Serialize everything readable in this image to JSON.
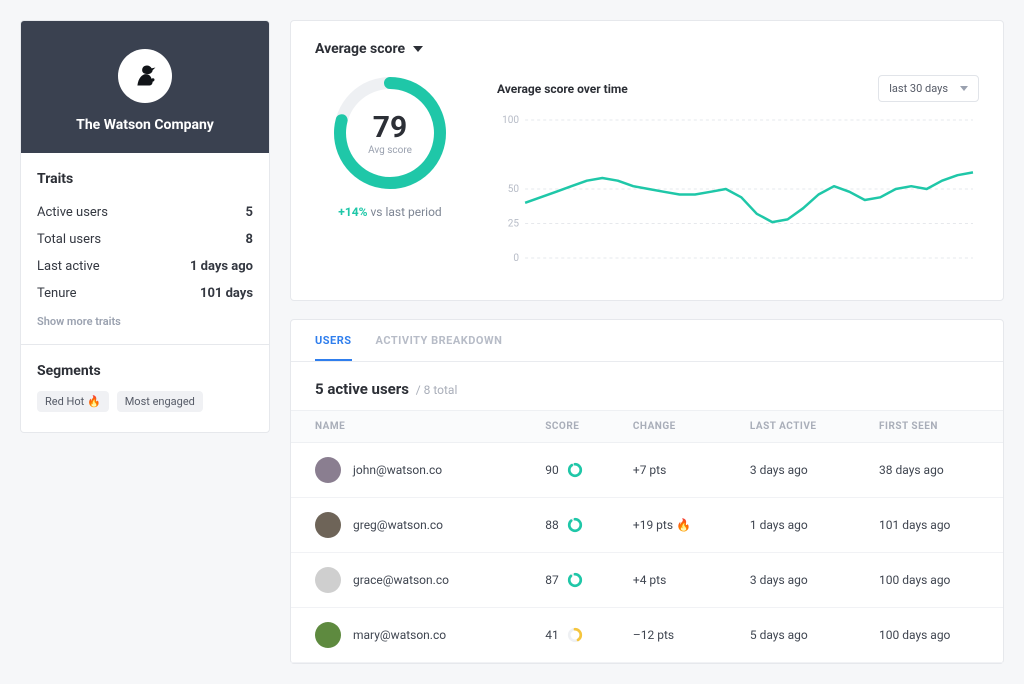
{
  "company": {
    "name": "The Watson Company"
  },
  "traits": {
    "title": "Traits",
    "rows": [
      {
        "label": "Active users",
        "value": "5"
      },
      {
        "label": "Total users",
        "value": "8"
      },
      {
        "label": "Last active",
        "value": "1 days ago"
      },
      {
        "label": "Tenure",
        "value": "101 days"
      }
    ],
    "show_more": "Show more traits"
  },
  "segments": {
    "title": "Segments",
    "tags": [
      "Red Hot 🔥",
      "Most engaged"
    ]
  },
  "score": {
    "header": "Average score",
    "value": "79",
    "value_label": "Avg score",
    "delta_pct": "+14%",
    "delta_suffix": "vs last period"
  },
  "chart_data": {
    "type": "line",
    "title": "Average score over time",
    "range_selected": "last 30 days",
    "ylim": [
      0,
      100
    ],
    "yticks": [
      0,
      25,
      50,
      100
    ],
    "x": [
      0,
      1,
      2,
      3,
      4,
      5,
      6,
      7,
      8,
      9,
      10,
      11,
      12,
      13,
      14,
      15,
      16,
      17,
      18,
      19,
      20,
      21,
      22,
      23,
      24,
      25,
      26,
      27,
      28,
      29
    ],
    "values": [
      40,
      44,
      48,
      52,
      56,
      58,
      56,
      52,
      50,
      48,
      46,
      46,
      48,
      50,
      44,
      32,
      26,
      28,
      36,
      46,
      52,
      48,
      42,
      44,
      50,
      52,
      50,
      56,
      60,
      62
    ]
  },
  "users_panel": {
    "tab_users": "USERS",
    "tab_activity": "ACTIVITY BREAKDOWN",
    "lead": "5 active users",
    "sub": "/ 8 total",
    "columns": {
      "name": "NAME",
      "score": "SCORE",
      "change": "CHANGE",
      "last_active": "LAST ACTIVE",
      "first_seen": "FIRST SEEN"
    },
    "rows": [
      {
        "email": "john@watson.co",
        "score": "90",
        "ring": "#1fc7a8",
        "ring_pct": 90,
        "change": "+7 pts",
        "last_active": "3 days ago",
        "first_seen": "38 days ago",
        "avatar": "#8a7e90"
      },
      {
        "email": "greg@watson.co",
        "score": "88",
        "ring": "#1fc7a8",
        "ring_pct": 88,
        "change": "+19 pts 🔥",
        "last_active": "1 days ago",
        "first_seen": "101 days ago",
        "avatar": "#6e6458"
      },
      {
        "email": "grace@watson.co",
        "score": "87",
        "ring": "#1fc7a8",
        "ring_pct": 87,
        "change": "+4 pts",
        "last_active": "3 days ago",
        "first_seen": "100 days ago",
        "avatar": "#cfcfcf"
      },
      {
        "email": "mary@watson.co",
        "score": "41",
        "ring": "#f5c53d",
        "ring_pct": 41,
        "change": "–12 pts",
        "last_active": "5 days ago",
        "first_seen": "100 days ago",
        "avatar": "#5e8a3f"
      }
    ]
  }
}
